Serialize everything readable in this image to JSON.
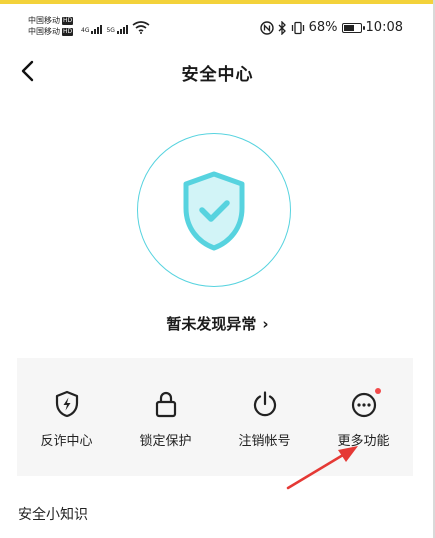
{
  "status_bar": {
    "carrier_1": "中国移动",
    "carrier_2": "中国移动",
    "hd_badge": "HD",
    "signal_1_tag": "4G",
    "signal_2_tag": "5G",
    "battery_percent": "68%",
    "battery_level": 0.68,
    "time": "10:08"
  },
  "header": {
    "title": "安全中心"
  },
  "security_status": {
    "text": "暂未发现异常",
    "chevron": "›",
    "shield_icon": "shield-check-icon"
  },
  "functions": [
    {
      "label": "反诈中心",
      "icon": "shield-bolt-icon"
    },
    {
      "label": "锁定保护",
      "icon": "lock-icon"
    },
    {
      "label": "注销帐号",
      "icon": "power-icon"
    },
    {
      "label": "更多功能",
      "icon": "more-dots-icon",
      "badge_dot": true
    }
  ],
  "section": {
    "title": "安全小知识"
  },
  "colors": {
    "accent_teal": "#57d3df",
    "shield_fill": "#d2f4f7",
    "badge_red": "#f24a4a",
    "annotation_arrow": "#e53935",
    "top_accent": "#f3d23a"
  }
}
